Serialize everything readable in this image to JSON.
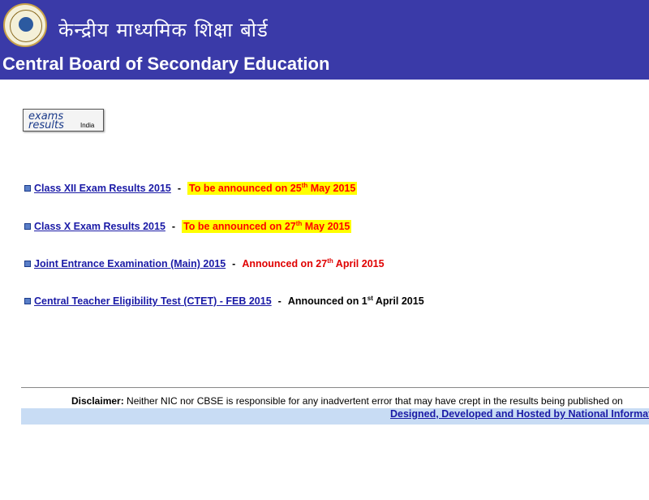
{
  "header": {
    "hindi_title": "केन्द्रीय माध्यमिक शिक्षा बोर्ड",
    "english_title": "Central Board of Secondary Education",
    "bg_color": "#3a3aa8",
    "emblem_icon": "cbse-emblem-icon"
  },
  "logo": {
    "line1": "exams",
    "line2": "results",
    "line3": "India"
  },
  "results": [
    {
      "link": "Class XII Exam Results 2015",
      "status_pre": "To be announced on 25",
      "status_sup": "th",
      "status_post": " May 2015"
    },
    {
      "link": "Class X Exam Results 2015",
      "status_pre": "To be announced on 27",
      "status_sup": "th",
      "status_post": " May 2015"
    },
    {
      "link": "Joint Entrance Examination (Main) 2015",
      "status_pre": "Announced on 27",
      "status_sup": "th",
      "status_post": " April 2015"
    },
    {
      "link": "Central Teacher Eligibility Test (CTET) - FEB 2015",
      "status_pre": "Announced on 1",
      "status_sup": "st",
      "status_post": " April 2015"
    }
  ],
  "separator": "-",
  "footer": {
    "disclaimer_label": "Disclaimer:",
    "disclaimer_text": " Neither NIC nor CBSE is responsible for any inadvertent error that may have crept in the results being published on",
    "credit_link": "Designed, Developed and Hosted by National Informatics Centre"
  },
  "colors": {
    "highlight": "#ffff00",
    "announce_red": "#e00000",
    "link_blue": "#1a1aa6",
    "footer_bar": "#c8dcf4"
  }
}
